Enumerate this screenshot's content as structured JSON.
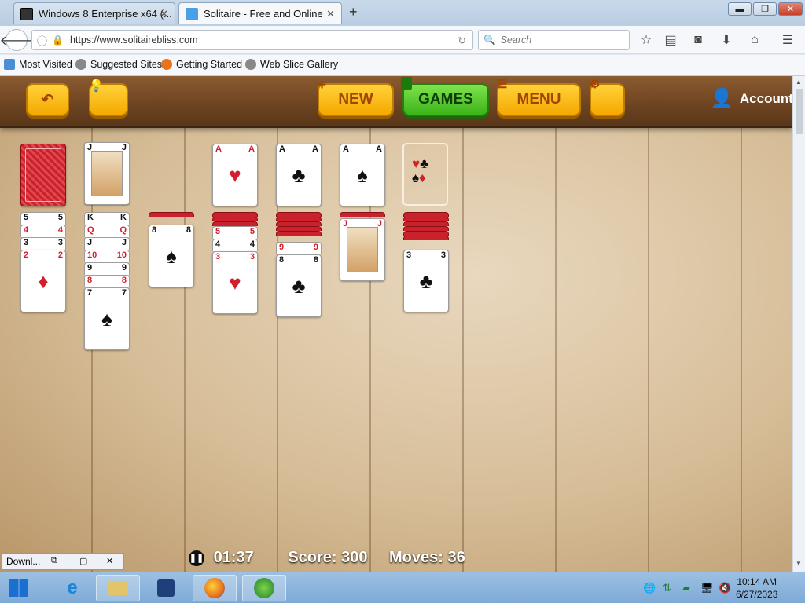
{
  "browser": {
    "tabs": [
      {
        "title": "Windows 8 Enterprise x64 (...",
        "active": false
      },
      {
        "title": "Solitaire - Free and Online",
        "active": true
      }
    ],
    "new_tab": "+",
    "url": "https://www.solitairebliss.com",
    "search_placeholder": "Search",
    "bookmarks": [
      "Most Visited",
      "Suggested Sites",
      "Getting Started",
      "Web Slice Gallery"
    ]
  },
  "game": {
    "buttons": {
      "new": "NEW",
      "games": "GAMES",
      "menu": "MENU"
    },
    "account": "Account",
    "timer": "01:37",
    "score_label": "Score: 300",
    "moves_label": "Moves: 36",
    "tableau": [
      {
        "col": 1,
        "hidden": 0,
        "cards": [
          "5♠",
          "4♦",
          "3♠",
          "2♦"
        ]
      },
      {
        "col": 2,
        "hidden": 0,
        "cards": [
          "K♠",
          "Q♦",
          "J♠",
          "10♥",
          "9♠",
          "8♦",
          "7♠"
        ]
      },
      {
        "col": 3,
        "hidden": 1,
        "cards": [
          "8♠"
        ]
      },
      {
        "col": 4,
        "hidden": 3,
        "cards": [
          "5♥",
          "4♠",
          "3♥"
        ]
      },
      {
        "col": 5,
        "hidden": 5,
        "cards": [
          "9♥",
          "8♣"
        ]
      },
      {
        "col": 6,
        "hidden": 1,
        "cards": [
          "J♦"
        ]
      },
      {
        "col": 7,
        "hidden": 6,
        "cards": [
          "3♣"
        ]
      }
    ],
    "stock": "face-down",
    "waste_top": "J♠",
    "foundations": [
      "A♥",
      "A♣",
      "A♠",
      ""
    ]
  },
  "taskbar": {
    "download_label": "Downl...",
    "time": "10:14 AM",
    "date": "6/27/2023"
  }
}
